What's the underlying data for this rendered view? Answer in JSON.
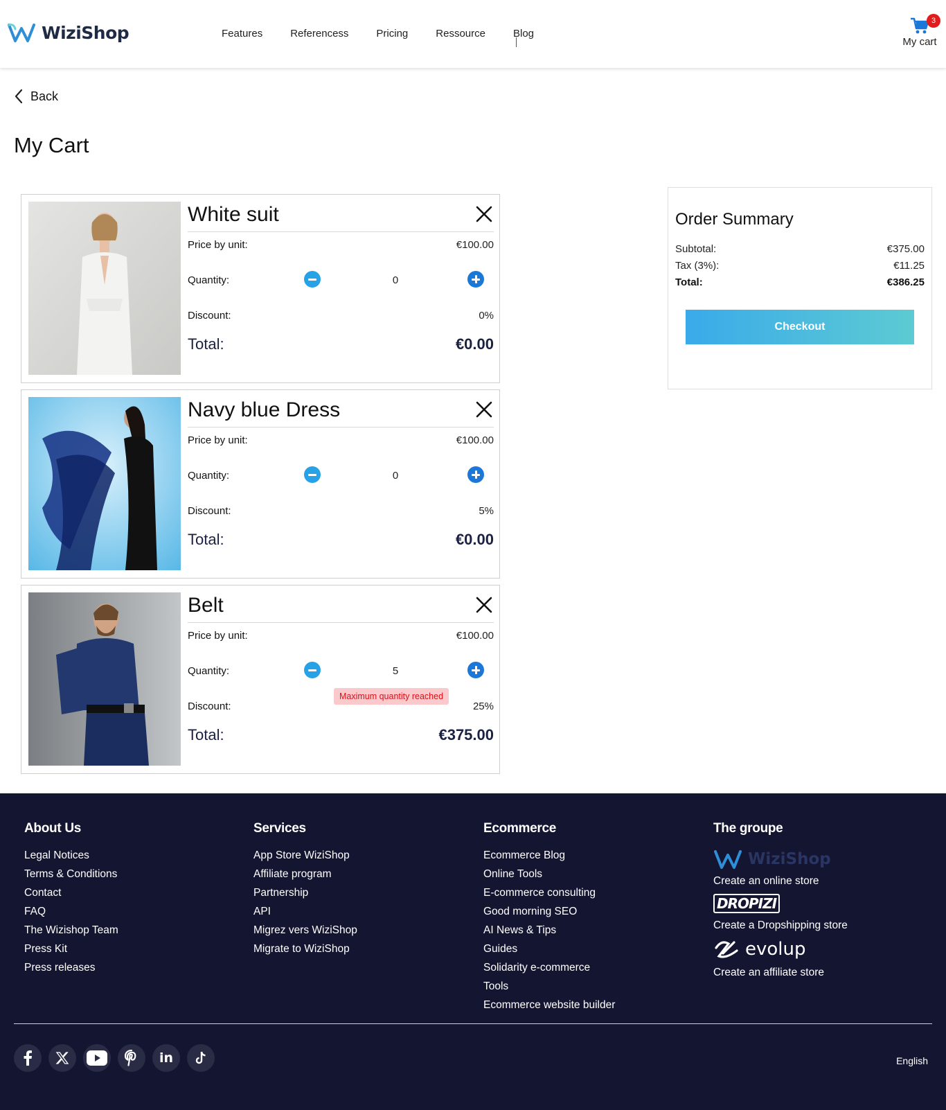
{
  "header": {
    "brand": "WiziShop",
    "nav": [
      "Features",
      "Referencess",
      "Pricing",
      "Ressource",
      "Blog"
    ],
    "cart_count": "3",
    "cart_label": "My cart"
  },
  "main": {
    "back_label": "Back",
    "title": "My Cart",
    "labels": {
      "price": "Price by unit:",
      "quantity": "Quantity:",
      "discount": "Discount:",
      "total": "Total:"
    },
    "items": [
      {
        "name": "White suit",
        "price": "€100.00",
        "quantity": "0",
        "discount": "0%",
        "total": "€0.00",
        "warning": ""
      },
      {
        "name": "Navy blue Dress",
        "price": "€100.00",
        "quantity": "0",
        "discount": "5%",
        "total": "€0.00",
        "warning": ""
      },
      {
        "name": "Belt",
        "price": "€100.00",
        "quantity": "5",
        "discount": "25%",
        "total": "€375.00",
        "warning": "Maximum quantity reached"
      }
    ]
  },
  "summary": {
    "title": "Order Summary",
    "subtotal_label": "Subtotal:",
    "subtotal": "€375.00",
    "tax_label": "Tax (3%):",
    "tax": "€11.25",
    "total_label": "Total:",
    "total": "€386.25",
    "checkout_label": "Checkout"
  },
  "footer": {
    "about": {
      "heading": "About Us",
      "links": [
        "Legal Notices",
        "Terms & Conditions",
        "Contact",
        "FAQ",
        "The Wizishop Team",
        "Press Kit",
        "Press releases"
      ]
    },
    "services": {
      "heading": "Services",
      "links": [
        "App Store WiziShop",
        "Affiliate program",
        "Partnership",
        "API",
        "Migrez vers WiziShop",
        "Migrate to WiziShop"
      ]
    },
    "ecommerce": {
      "heading": "Ecommerce",
      "links": [
        "Ecommerce Blog",
        "Online Tools",
        "E-commerce consulting",
        "Good morning SEO",
        "AI News & Tips",
        "Guides",
        "Solidarity e-commerce",
        "Tools",
        "Ecommerce website builder"
      ]
    },
    "groupe": {
      "heading": "The groupe",
      "brands": [
        {
          "name": "WiziShop",
          "caption": "Create an online store"
        },
        {
          "name": "DROPIZI",
          "caption": "Create a Dropshipping store"
        },
        {
          "name": "evolup",
          "caption": "Create an affiliate store"
        }
      ]
    },
    "socials": [
      "facebook-icon",
      "x-icon",
      "youtube-icon",
      "pinterest-icon",
      "linkedin-icon",
      "tiktok-icon"
    ],
    "language": "English"
  },
  "colors": {
    "accent": "#27a2e6",
    "footer_bg": "#141631",
    "warning_bg": "#f9c9cb",
    "warning_text": "#d8101b",
    "badge": "#e21b1b"
  }
}
